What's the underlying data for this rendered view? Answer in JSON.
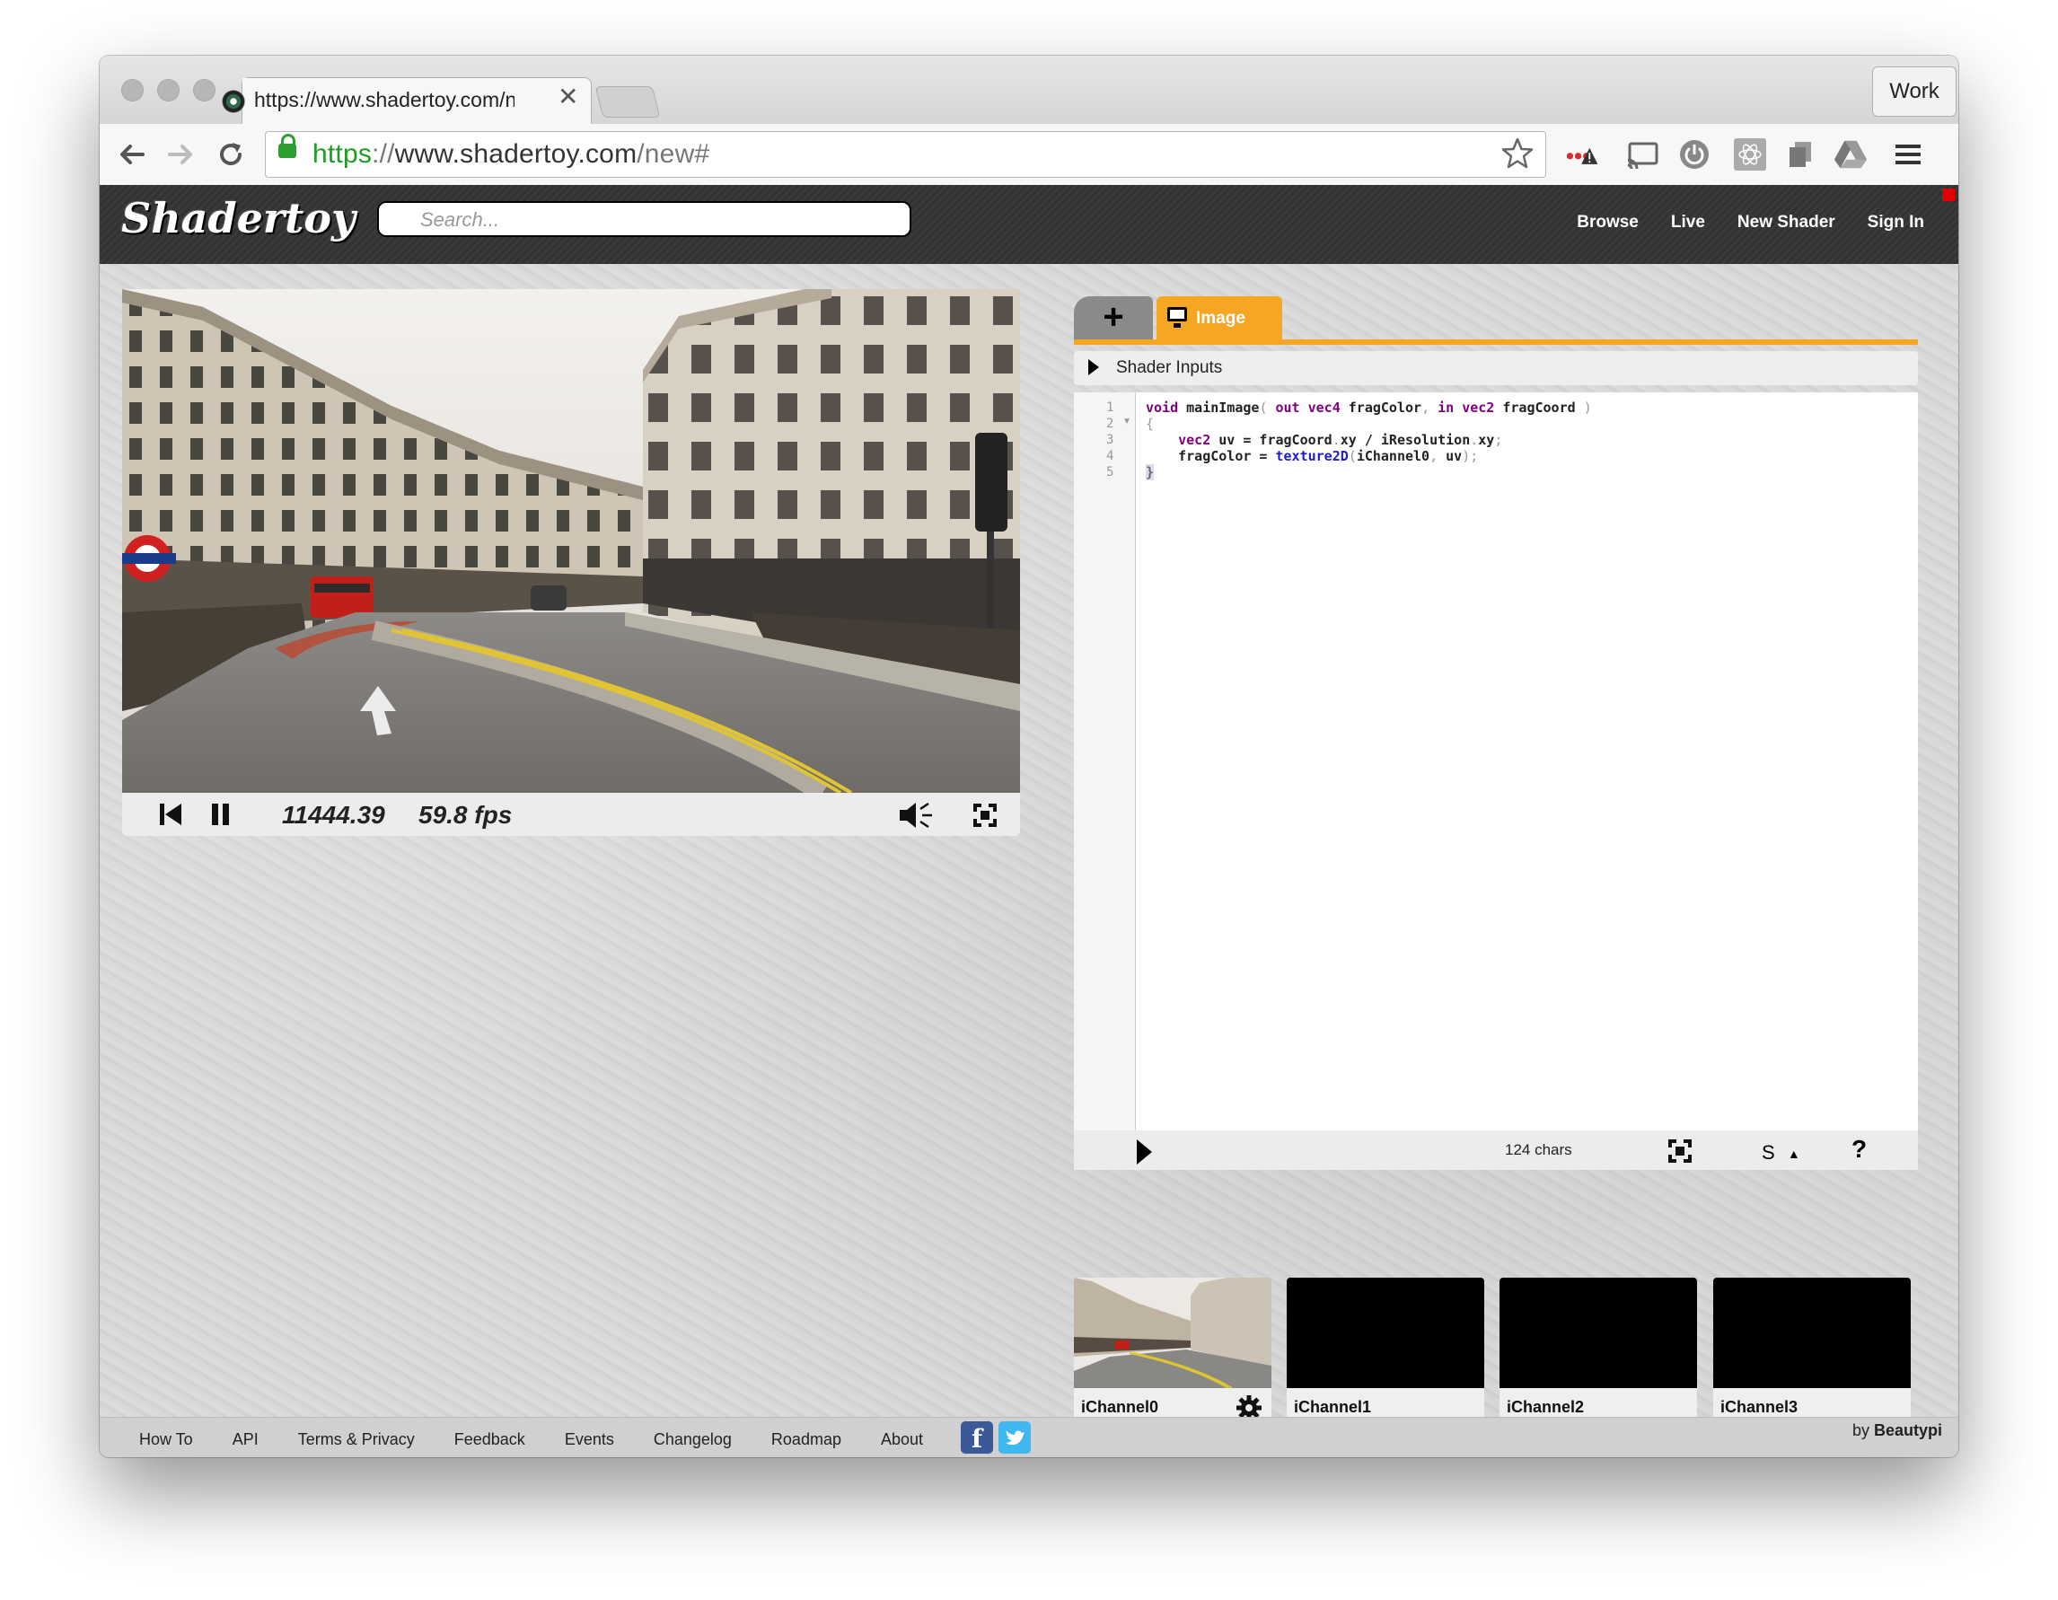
{
  "browser": {
    "tab_title": "https://www.shadertoy.com/new#",
    "tab_close": "✕",
    "profile_button": "Work",
    "url_scheme": "https",
    "url_sep": "://",
    "url_host": "www.shadertoy.com",
    "url_path": "/new#"
  },
  "site": {
    "logo": "Shadertoy",
    "search_placeholder": "Search...",
    "nav": [
      "Browse",
      "Live",
      "New Shader",
      "Sign In"
    ]
  },
  "player": {
    "time": "11444.39",
    "fps": "59.8 fps"
  },
  "editor": {
    "tab_add": "+",
    "tab_image": "Image",
    "shader_inputs": "Shader Inputs",
    "line_numbers": [
      "1",
      "2",
      "3",
      "4",
      "5"
    ],
    "chars": "124 chars",
    "font_size_label": "S",
    "help": "?"
  },
  "channels": [
    "iChannel0",
    "iChannel1",
    "iChannel2",
    "iChannel3"
  ],
  "footer": {
    "links": [
      "How To",
      "API",
      "Terms & Privacy",
      "Feedback",
      "Events",
      "Changelog",
      "Roadmap",
      "About"
    ],
    "by_prefix": "by",
    "by_name": "Beautypi"
  },
  "icons": {
    "back": "back-arrow-icon",
    "forward": "forward-arrow-icon",
    "reload": "reload-icon",
    "bookmark": "star-icon",
    "rewind": "rewind-icon",
    "pause": "pause-icon",
    "volume": "volume-icon",
    "fullscreen": "fullscreen-icon",
    "run": "play-icon",
    "gear": "gear-icon"
  },
  "colors": {
    "accent": "#f5a623",
    "header_bg": "#3a3a3a",
    "url_green": "#1f9b24"
  }
}
